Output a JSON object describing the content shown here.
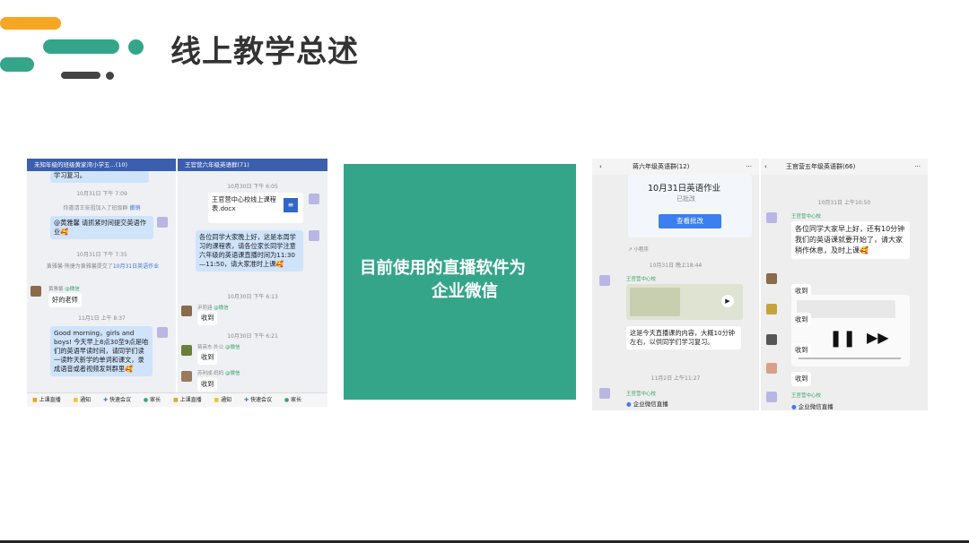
{
  "slide": {
    "title": "线上教学总述"
  },
  "colors": {
    "orange": "#f5a623",
    "teal": "#35a58a",
    "dark": "#444444",
    "chat_bubble": "#cfe3fb",
    "topbar": "#3b5fae"
  },
  "left_shot": {
    "pane1": {
      "header": "未知年级的班级黄家湾小学五...(10)",
      "msg0": "学习复习。",
      "ts1": "10月31日 下午 7:09",
      "sys1_text": "你邀请王安祖加入了班级群",
      "sys1_link": "撤销",
      "msg1": "@黄雅馨 请抓紧时间提交英语作业🥰",
      "ts2": "10月31日 下午 7:35",
      "sys2_text": "黄雅馨·熊捷为黄雅馨提交了",
      "sys2_link": "10月31日英语作业",
      "name3": "黄雅馨",
      "name3_tag": "@微信",
      "msg3": "好的老师",
      "ts4": "11月1日 上午 8:37",
      "msg4": "Good morning，girls and boys! 今天早上8点30至9点是咱们的英语早读时间，请同学们读一读昨天新学的单词和课文，录成语音或者视频发到群里🥰"
    },
    "pane2": {
      "header": "王官营六年级英语群(71)",
      "ts1": "10月30日 下午 6:05",
      "file_name": "王官营中心校线上课程表.docx",
      "msg2": "各位同学大家晚上好，这是本周学习的课程表，请各位家长同学注意六年级的英语课直播时间为11:30—11:50，请大家准时上课🥰",
      "ts3": "10月30日 下午 6:13",
      "name3": "尹莉涵",
      "name3_tag": "@微信",
      "msg3": "收到",
      "ts4": "10月30日 下午 6:21",
      "name4": "蒋英东·外公",
      "name4_tag": "@微信",
      "msg4": "收到",
      "name5": "苏利成·妈妈",
      "name5_tag": "@微信",
      "msg5": "收到"
    },
    "bottom": [
      "上课直播",
      "通知",
      "快速会议",
      "家长"
    ]
  },
  "center_card": {
    "line1": "目前使用的直播软件为",
    "line2": "企业微信"
  },
  "right_shot": {
    "pane1": {
      "header": "蒋六年级英语群(12)",
      "card_title": "10月31日英语作业",
      "card_status": "已批改",
      "card_button": "查看批改",
      "mini_program": "小程序",
      "ts1": "10月31日 晚上18:44",
      "sender1": "王官营中心校",
      "msg1": "这是今天直播课的内容，大概10分钟左右，以供同学们学习复习。",
      "ts2": "11月2日 上午11:27",
      "sender2": "王官营中心校",
      "msg2": "企业微信直播"
    },
    "pane2": {
      "header": "王官营五年级英语群(66)",
      "ts1": "10月31日 上午10:50",
      "sender1": "王官营中心校",
      "msg1": "各位同学大家早上好，还有10分钟我们的英语课就要开始了，请大家稍作休息，及时上课🥰",
      "msg2": "收到",
      "msg3": "收到",
      "msg4": "收到",
      "msg5": "收到",
      "sender6": "王官营中心校",
      "msg6": "企业微信直播"
    }
  }
}
